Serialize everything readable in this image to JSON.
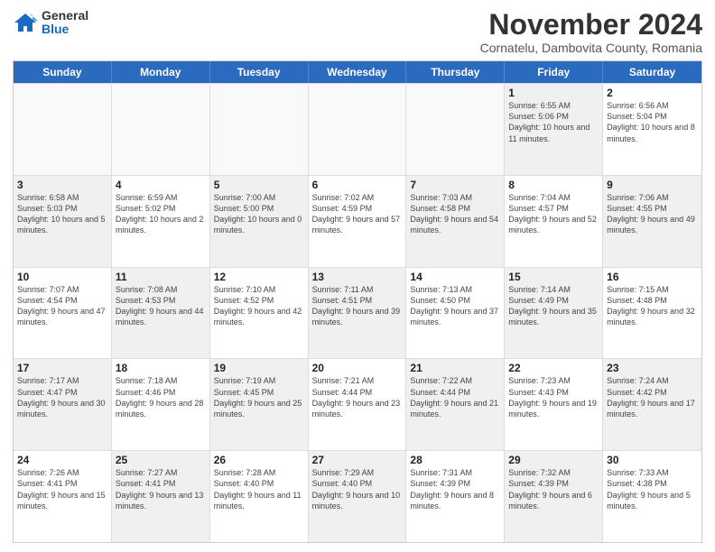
{
  "logo": {
    "general": "General",
    "blue": "Blue"
  },
  "title": "November 2024",
  "subtitle": "Cornatelu, Dambovita County, Romania",
  "headers": [
    "Sunday",
    "Monday",
    "Tuesday",
    "Wednesday",
    "Thursday",
    "Friday",
    "Saturday"
  ],
  "rows": [
    [
      {
        "day": "",
        "text": "",
        "empty": true
      },
      {
        "day": "",
        "text": "",
        "empty": true
      },
      {
        "day": "",
        "text": "",
        "empty": true
      },
      {
        "day": "",
        "text": "",
        "empty": true
      },
      {
        "day": "",
        "text": "",
        "empty": true
      },
      {
        "day": "1",
        "text": "Sunrise: 6:55 AM\nSunset: 5:06 PM\nDaylight: 10 hours and 11 minutes.",
        "empty": false,
        "shaded": true
      },
      {
        "day": "2",
        "text": "Sunrise: 6:56 AM\nSunset: 5:04 PM\nDaylight: 10 hours and 8 minutes.",
        "empty": false,
        "shaded": false
      }
    ],
    [
      {
        "day": "3",
        "text": "Sunrise: 6:58 AM\nSunset: 5:03 PM\nDaylight: 10 hours and 5 minutes.",
        "empty": false,
        "shaded": true
      },
      {
        "day": "4",
        "text": "Sunrise: 6:59 AM\nSunset: 5:02 PM\nDaylight: 10 hours and 2 minutes.",
        "empty": false,
        "shaded": false
      },
      {
        "day": "5",
        "text": "Sunrise: 7:00 AM\nSunset: 5:00 PM\nDaylight: 10 hours and 0 minutes.",
        "empty": false,
        "shaded": true
      },
      {
        "day": "6",
        "text": "Sunrise: 7:02 AM\nSunset: 4:59 PM\nDaylight: 9 hours and 57 minutes.",
        "empty": false,
        "shaded": false
      },
      {
        "day": "7",
        "text": "Sunrise: 7:03 AM\nSunset: 4:58 PM\nDaylight: 9 hours and 54 minutes.",
        "empty": false,
        "shaded": true
      },
      {
        "day": "8",
        "text": "Sunrise: 7:04 AM\nSunset: 4:57 PM\nDaylight: 9 hours and 52 minutes.",
        "empty": false,
        "shaded": false
      },
      {
        "day": "9",
        "text": "Sunrise: 7:06 AM\nSunset: 4:55 PM\nDaylight: 9 hours and 49 minutes.",
        "empty": false,
        "shaded": true
      }
    ],
    [
      {
        "day": "10",
        "text": "Sunrise: 7:07 AM\nSunset: 4:54 PM\nDaylight: 9 hours and 47 minutes.",
        "empty": false,
        "shaded": false
      },
      {
        "day": "11",
        "text": "Sunrise: 7:08 AM\nSunset: 4:53 PM\nDaylight: 9 hours and 44 minutes.",
        "empty": false,
        "shaded": true
      },
      {
        "day": "12",
        "text": "Sunrise: 7:10 AM\nSunset: 4:52 PM\nDaylight: 9 hours and 42 minutes.",
        "empty": false,
        "shaded": false
      },
      {
        "day": "13",
        "text": "Sunrise: 7:11 AM\nSunset: 4:51 PM\nDaylight: 9 hours and 39 minutes.",
        "empty": false,
        "shaded": true
      },
      {
        "day": "14",
        "text": "Sunrise: 7:13 AM\nSunset: 4:50 PM\nDaylight: 9 hours and 37 minutes.",
        "empty": false,
        "shaded": false
      },
      {
        "day": "15",
        "text": "Sunrise: 7:14 AM\nSunset: 4:49 PM\nDaylight: 9 hours and 35 minutes.",
        "empty": false,
        "shaded": true
      },
      {
        "day": "16",
        "text": "Sunrise: 7:15 AM\nSunset: 4:48 PM\nDaylight: 9 hours and 32 minutes.",
        "empty": false,
        "shaded": false
      }
    ],
    [
      {
        "day": "17",
        "text": "Sunrise: 7:17 AM\nSunset: 4:47 PM\nDaylight: 9 hours and 30 minutes.",
        "empty": false,
        "shaded": true
      },
      {
        "day": "18",
        "text": "Sunrise: 7:18 AM\nSunset: 4:46 PM\nDaylight: 9 hours and 28 minutes.",
        "empty": false,
        "shaded": false
      },
      {
        "day": "19",
        "text": "Sunrise: 7:19 AM\nSunset: 4:45 PM\nDaylight: 9 hours and 25 minutes.",
        "empty": false,
        "shaded": true
      },
      {
        "day": "20",
        "text": "Sunrise: 7:21 AM\nSunset: 4:44 PM\nDaylight: 9 hours and 23 minutes.",
        "empty": false,
        "shaded": false
      },
      {
        "day": "21",
        "text": "Sunrise: 7:22 AM\nSunset: 4:44 PM\nDaylight: 9 hours and 21 minutes.",
        "empty": false,
        "shaded": true
      },
      {
        "day": "22",
        "text": "Sunrise: 7:23 AM\nSunset: 4:43 PM\nDaylight: 9 hours and 19 minutes.",
        "empty": false,
        "shaded": false
      },
      {
        "day": "23",
        "text": "Sunrise: 7:24 AM\nSunset: 4:42 PM\nDaylight: 9 hours and 17 minutes.",
        "empty": false,
        "shaded": true
      }
    ],
    [
      {
        "day": "24",
        "text": "Sunrise: 7:26 AM\nSunset: 4:41 PM\nDaylight: 9 hours and 15 minutes.",
        "empty": false,
        "shaded": false
      },
      {
        "day": "25",
        "text": "Sunrise: 7:27 AM\nSunset: 4:41 PM\nDaylight: 9 hours and 13 minutes.",
        "empty": false,
        "shaded": true
      },
      {
        "day": "26",
        "text": "Sunrise: 7:28 AM\nSunset: 4:40 PM\nDaylight: 9 hours and 11 minutes.",
        "empty": false,
        "shaded": false
      },
      {
        "day": "27",
        "text": "Sunrise: 7:29 AM\nSunset: 4:40 PM\nDaylight: 9 hours and 10 minutes.",
        "empty": false,
        "shaded": true
      },
      {
        "day": "28",
        "text": "Sunrise: 7:31 AM\nSunset: 4:39 PM\nDaylight: 9 hours and 8 minutes.",
        "empty": false,
        "shaded": false
      },
      {
        "day": "29",
        "text": "Sunrise: 7:32 AM\nSunset: 4:39 PM\nDaylight: 9 hours and 6 minutes.",
        "empty": false,
        "shaded": true
      },
      {
        "day": "30",
        "text": "Sunrise: 7:33 AM\nSunset: 4:38 PM\nDaylight: 9 hours and 5 minutes.",
        "empty": false,
        "shaded": false
      }
    ]
  ]
}
